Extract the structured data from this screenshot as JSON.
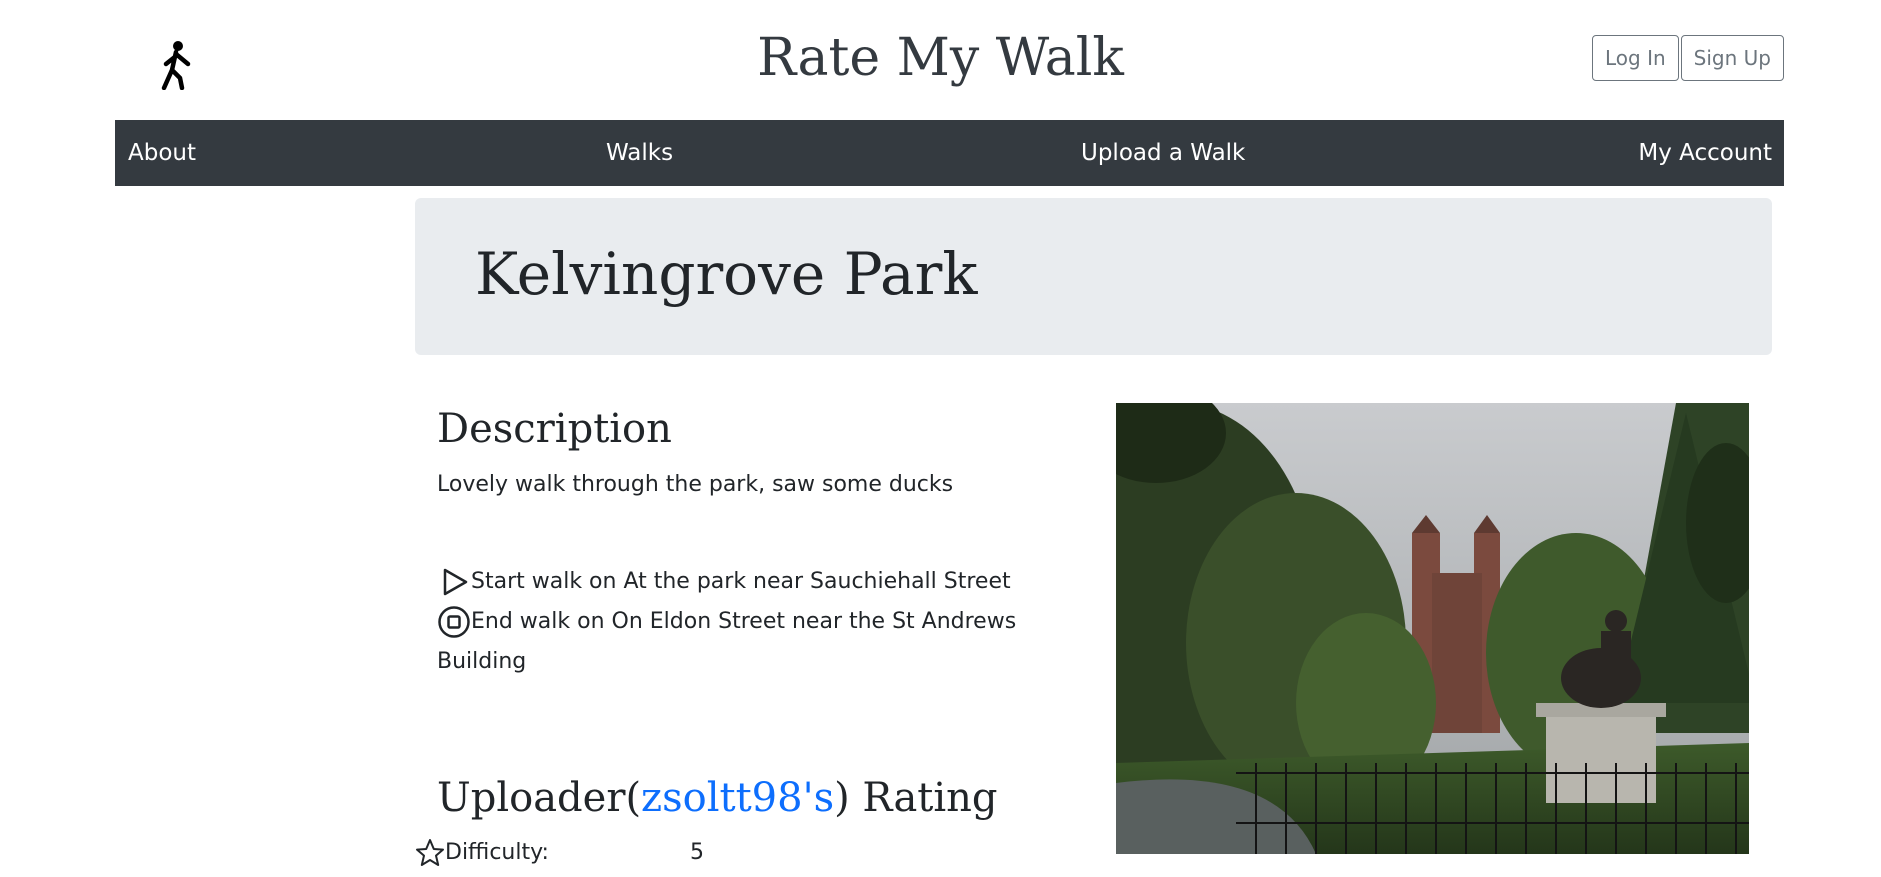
{
  "header": {
    "title": "Rate My Walk",
    "login_label": "Log In",
    "signup_label": "Sign Up"
  },
  "nav": {
    "items": [
      {
        "label": "About"
      },
      {
        "label": "Walks"
      },
      {
        "label": "Upload a Walk"
      },
      {
        "label": "My Account"
      }
    ]
  },
  "walk": {
    "name": "Kelvingrove Park",
    "description_heading": "Description",
    "description": "Lovely walk through the park, saw some ducks",
    "start_text": "Start walk on At the park near Sauchiehall Street",
    "end_text": "End walk on On Eldon Street near the St Andrews Building",
    "rating_heading_prefix": "Uploader(",
    "uploader": "zsoltt98's",
    "rating_heading_suffix": ") Rating",
    "difficulty_label": "Difficulty:",
    "difficulty_value": "5"
  },
  "colors": {
    "navbar": "#343a40",
    "jumbotron": "#e9ecef",
    "link": "#0d6efd"
  }
}
